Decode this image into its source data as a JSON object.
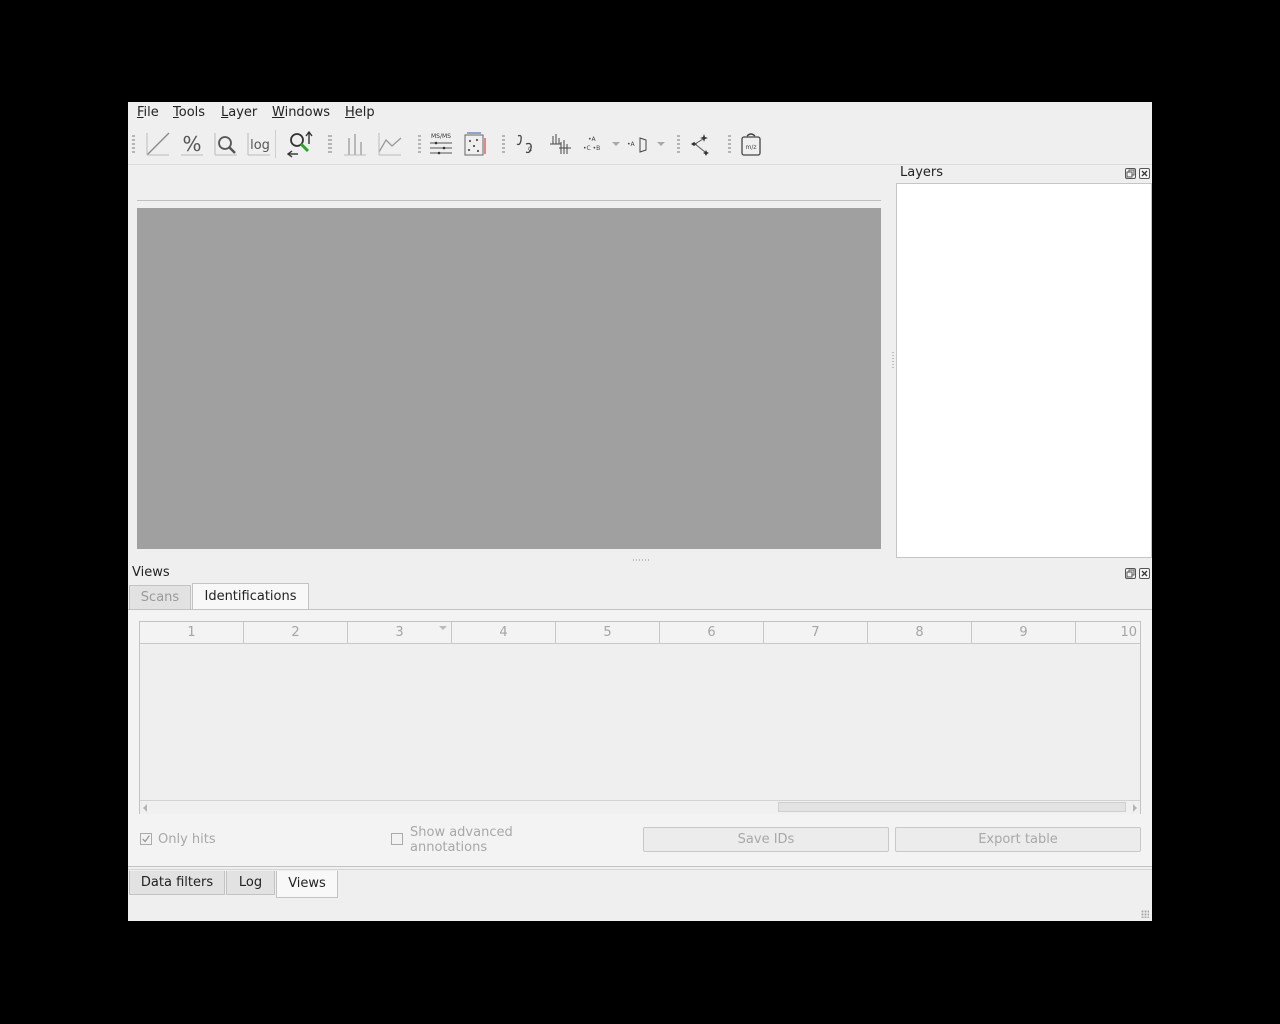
{
  "menubar": {
    "items": [
      {
        "label": "File",
        "mnemonic": "F",
        "rest": "ile"
      },
      {
        "label": "Tools",
        "mnemonic": "T",
        "rest": "ools"
      },
      {
        "label": "Layer",
        "mnemonic": "L",
        "rest": "ayer"
      },
      {
        "label": "Windows",
        "mnemonic": "W",
        "rest": "indows"
      },
      {
        "label": "Help",
        "mnemonic": "H",
        "rest": "elp"
      }
    ]
  },
  "toolbar": {
    "log_label": "log",
    "msms_label": "MS/MS",
    "mz_label": "m/z"
  },
  "layers_dock": {
    "title": "Layers"
  },
  "views_dock": {
    "title": "Views",
    "tabs": [
      "Scans",
      "Identifications"
    ],
    "active_tab": "Identifications",
    "table": {
      "columns": [
        "1",
        "2",
        "3",
        "4",
        "5",
        "6",
        "7",
        "8",
        "9",
        "10"
      ]
    },
    "only_hits": {
      "label": "Only hits",
      "checked": true
    },
    "show_advanced": {
      "label_line1": "Show advanced",
      "label_line2": "annotations",
      "checked": false
    },
    "save_ids_label": "Save IDs",
    "export_table_label": "Export table"
  },
  "bottom_tabs": {
    "items": [
      "Data filters",
      "Log",
      "Views"
    ],
    "active": "Views"
  },
  "colors": {
    "canvas": "#a0a0a0",
    "window": "#efefef",
    "highlight_green": "#2aa52a"
  }
}
